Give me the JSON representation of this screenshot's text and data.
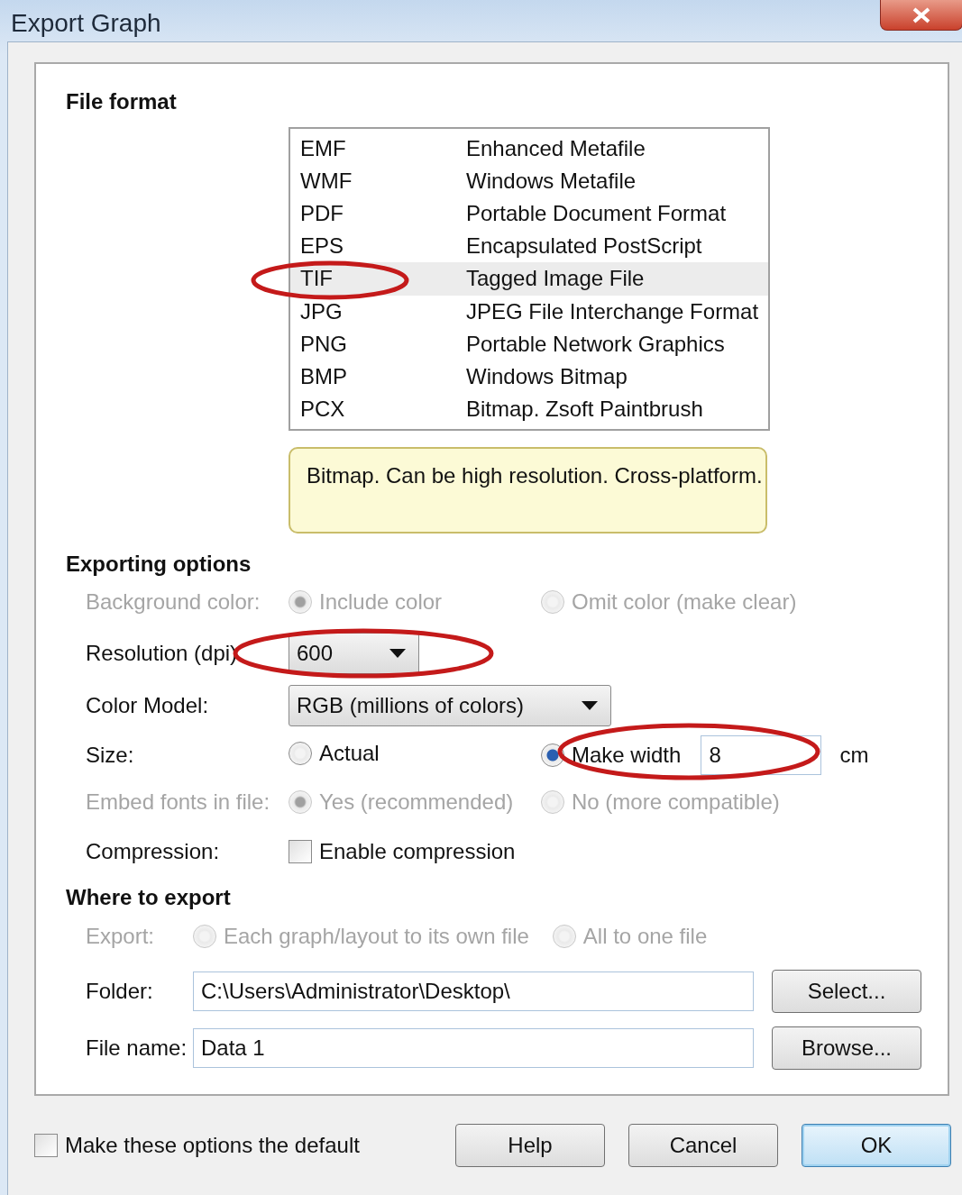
{
  "window": {
    "title": "Export Graph"
  },
  "file_format": {
    "heading": "File format",
    "formats": [
      {
        "code": "EMF",
        "description": "Enhanced Metafile",
        "selected": false,
        "circled": false
      },
      {
        "code": "WMF",
        "description": "Windows Metafile",
        "selected": false,
        "circled": false
      },
      {
        "code": "PDF",
        "description": "Portable Document Format",
        "selected": false,
        "circled": false
      },
      {
        "code": "EPS",
        "description": "Encapsulated PostScript",
        "selected": false,
        "circled": false
      },
      {
        "code": "TIF",
        "description": "Tagged Image File",
        "selected": true,
        "circled": true
      },
      {
        "code": "JPG",
        "description": "JPEG File Interchange Format",
        "selected": false,
        "circled": false
      },
      {
        "code": "PNG",
        "description": "Portable Network Graphics",
        "selected": false,
        "circled": false
      },
      {
        "code": "BMP",
        "description": "Windows Bitmap",
        "selected": false,
        "circled": false
      },
      {
        "code": "PCX",
        "description": "Bitmap. Zsoft Paintbrush",
        "selected": false,
        "circled": false
      }
    ],
    "description": "Bitmap. Can be high resolution. Cross-platform."
  },
  "exporting_options": {
    "heading": "Exporting options",
    "rows": [
      {
        "kind": "radio",
        "label": "Background color:",
        "disabled": true,
        "options": [
          {
            "label": "Include color",
            "selected": true
          },
          {
            "label": "Omit color (make clear)",
            "selected": false
          }
        ]
      },
      {
        "kind": "select",
        "label": "Resolution (dpi)",
        "disabled": false,
        "value": "600",
        "wide": false,
        "circled": true
      },
      {
        "kind": "select",
        "label": "Color Model:",
        "disabled": false,
        "value": "RGB (millions of colors)",
        "wide": true,
        "circled": false
      },
      {
        "kind": "size",
        "label": "Size:",
        "disabled": false,
        "options": [
          {
            "label": "Actual",
            "selected": false,
            "circled": false
          },
          {
            "label": "Make width",
            "selected": true,
            "circled": true
          }
        ],
        "value": "8",
        "unit": "cm"
      },
      {
        "kind": "radio",
        "label": "Embed fonts in file:",
        "disabled": true,
        "options": [
          {
            "label": "Yes (recommended)",
            "selected": true
          },
          {
            "label": "No (more compatible)",
            "selected": false
          }
        ]
      },
      {
        "kind": "checkbox",
        "label": "Compression:",
        "disabled": false,
        "option": "Enable compression",
        "checked": false
      }
    ]
  },
  "where_to_export": {
    "heading": "Where to export",
    "export": {
      "label": "Export:",
      "disabled": true,
      "options": [
        {
          "label": "Each graph/layout to its own file",
          "selected": false
        },
        {
          "label": "All to one file",
          "selected": false
        }
      ]
    },
    "fields": [
      {
        "label": "Folder:",
        "value": "C:\\Users\\Administrator\\Desktop\\",
        "button": "Select..."
      },
      {
        "label": "File name:",
        "value": "Data 1",
        "button": "Browse..."
      }
    ]
  },
  "footer": {
    "default_option": {
      "label": "Make these options the default",
      "checked": false
    },
    "buttons": [
      {
        "label": "Help",
        "default": false
      },
      {
        "label": "Cancel",
        "default": false
      },
      {
        "label": "OK",
        "default": true
      }
    ]
  }
}
